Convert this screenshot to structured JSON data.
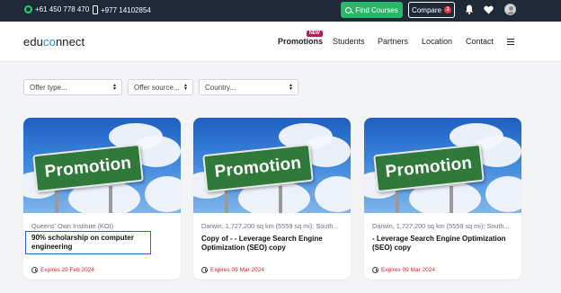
{
  "topbar": {
    "whatsapp_number": "+61 450 778 470",
    "mobile_number": "+977 14102854",
    "find_courses_label": "Find Courses",
    "compare_label": "Compare",
    "compare_count": "3"
  },
  "navbar": {
    "logo_prefix": "edu",
    "logo_mid": "co",
    "logo_suffix": "nnect",
    "items": [
      {
        "label": "Promotions",
        "badge": "NEW"
      },
      {
        "label": "Students"
      },
      {
        "label": "Partners"
      },
      {
        "label": "Location"
      },
      {
        "label": "Contact"
      }
    ]
  },
  "filters": {
    "offer_type": "Offer type...",
    "offer_source": "Offer source...",
    "country": "Country..."
  },
  "cards": [
    {
      "image_text": "Promotion",
      "location": "Queens' Own Institute (KOI)",
      "title": "90% scholarship on computer engineering",
      "expires": "Expires 29 Feb 2024"
    },
    {
      "image_text": "Promotion",
      "location": "Darwin, 1,727,200 sq km (5559 sq mi); South...",
      "title": "Copy of - - Leverage Search Engine Optimization (SEO) copy",
      "expires": "Expires 09 Mar 2024"
    },
    {
      "image_text": "Promotion",
      "location": "Darwin, 1,727,200 sq km (5559 sq mi); South...",
      "title": "- Leverage Search Engine Optimization (SEO) copy",
      "expires": "Expires 09 Mar 2024"
    }
  ],
  "colors": {
    "topbar_bg": "#1f2937",
    "find_courses_bg": "#27b86a",
    "accent_blue": "#1e88e5",
    "new_badge": "#c2185b",
    "expires_red": "#dc2626"
  }
}
